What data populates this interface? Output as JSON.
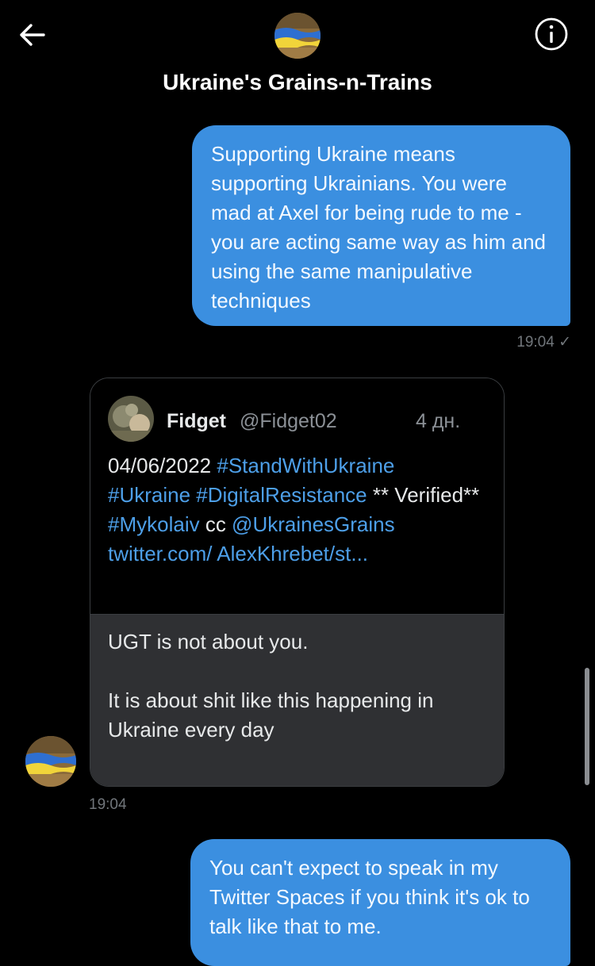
{
  "header": {
    "back_icon": "arrow-left-icon",
    "info_icon": "info-icon",
    "title": "Ukraine's Grains-n-Trains"
  },
  "messages": {
    "outgoing_1": {
      "text": "Supporting Ukraine means supporting Ukrainians. You were mad at Axel for being rude to me - you are acting same way as him and using the same manipulative techniques",
      "time": "19:04 ✓"
    },
    "incoming_1": {
      "quoted_tweet": {
        "author_name": "Fidget",
        "author_handle": "@Fidget02",
        "age": "4 дн.",
        "date": "04/06/2022",
        "tag1": "#StandWithUkraine",
        "tag2": "#Ukraine",
        "tag3": "#DigitalResistance",
        "verified": " ** Verified** ",
        "tag4": "#Mykolaiv",
        "cc": " cc ",
        "mention": "@UkrainesGrains",
        "link": "twitter.com/ AlexKhrebet/st..."
      },
      "reply_line1": "UGT is not about you.",
      "reply_line2": "It is about shit like this happening in Ukraine every day",
      "time": "19:04"
    },
    "outgoing_2": {
      "text": "You can't expect to speak in my Twitter Spaces if you think it's ok to talk like that to me."
    }
  },
  "colors": {
    "background": "#000000",
    "outgoing_bubble": "#3b8fe0",
    "incoming_bubble": "#2f3033",
    "link": "#4d9fe8"
  }
}
